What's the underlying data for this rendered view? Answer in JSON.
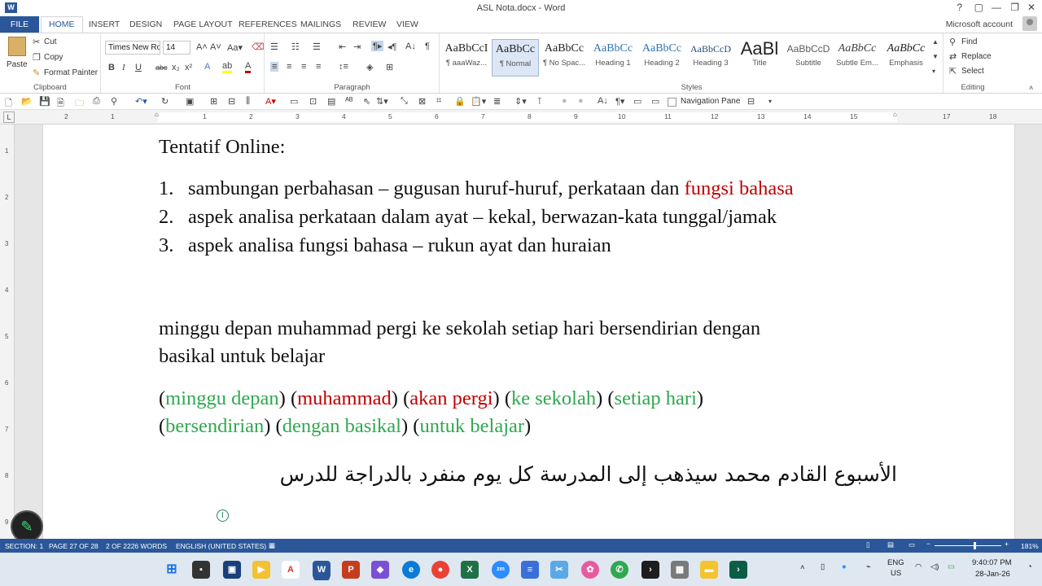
{
  "window": {
    "title": "ASL Nota.docx - Word",
    "app_icon": "W",
    "controls": [
      "?",
      "▢",
      "—",
      "❐",
      "✕"
    ]
  },
  "tabs": [
    "FILE",
    "HOME",
    "INSERT",
    "DESIGN",
    "PAGE LAYOUT",
    "REFERENCES",
    "MAILINGS",
    "REVIEW",
    "VIEW"
  ],
  "account": "Microsoft account",
  "ribbon": {
    "clipboard": {
      "paste": "Paste",
      "cut": "Cut",
      "copy": "Copy",
      "format_painter": "Format Painter",
      "label": "Clipboard"
    },
    "font": {
      "name": "Times New Ro",
      "size": "14",
      "label": "Font"
    },
    "paragraph": {
      "label": "Paragraph"
    },
    "styles": {
      "label": "Styles",
      "items": [
        {
          "preview": "AaBbCcI",
          "name": "¶ aaaWaz..."
        },
        {
          "preview": "AaBbCc",
          "name": "¶ Normal"
        },
        {
          "preview": "AaBbCc",
          "name": "¶ No Spac..."
        },
        {
          "preview": "AaBbCc",
          "name": "Heading 1"
        },
        {
          "preview": "AaBbCc",
          "name": "Heading 2"
        },
        {
          "preview": "AaBbCcD",
          "name": "Heading 3"
        },
        {
          "preview": "AaBl",
          "name": "Title"
        },
        {
          "preview": "AaBbCcD",
          "name": "Subtitle"
        },
        {
          "preview": "AaBbCc",
          "name": "Subtle Em..."
        },
        {
          "preview": "AaBbCc",
          "name": "Emphasis"
        }
      ]
    },
    "editing": {
      "find": "Find",
      "replace": "Replace",
      "select": "Select",
      "label": "Editing"
    }
  },
  "qat": {
    "navigation_pane": "Navigation Pane"
  },
  "ruler": {
    "numbers": [
      "2",
      "1",
      "1",
      "2",
      "3",
      "4",
      "5",
      "6",
      "7",
      "8",
      "9",
      "10",
      "11",
      "12",
      "13",
      "14",
      "15",
      "16",
      "17",
      "18"
    ],
    "tab_marker": "L"
  },
  "vruler": [
    "1",
    "2",
    "3",
    "4",
    "5",
    "6",
    "7",
    "8",
    "9"
  ],
  "document": {
    "heading": "Tentatif Online:",
    "list": [
      {
        "n": "1.",
        "text": "sambungan perbahasan – gugusan huruf-huruf, perkataan dan ",
        "highlight": "fungsi bahasa"
      },
      {
        "n": "2.",
        "text": "aspek analisa perkataan dalam ayat – kekal, berwazan-kata tunggal/jamak",
        "highlight": ""
      },
      {
        "n": "3.",
        "text": "aspek analisa fungsi bahasa – rukun ayat dan huraian",
        "highlight": ""
      }
    ],
    "sentence_line1": "minggu depan muhammad pergi ke sekolah setiap hari bersendirian dengan",
    "sentence_line2": "basikal untuk belajar",
    "phrases_line1": [
      {
        "text": "minggu depan",
        "color": "green"
      },
      {
        "text": "muhammad",
        "color": "red"
      },
      {
        "text": "akan pergi",
        "color": "red"
      },
      {
        "text": "ke sekolah",
        "color": "green"
      },
      {
        "text": "setiap hari",
        "color": "green"
      }
    ],
    "phrases_line2": [
      {
        "text": "bersendirian",
        "color": "green"
      },
      {
        "text": "dengan basikal",
        "color": "green"
      },
      {
        "text": "untuk belajar",
        "color": "green"
      }
    ],
    "arabic": "الأسبوع القادم محمد سيذهب إلى المدرسة كل يوم منفرد بالدراجة للدرس"
  },
  "status": {
    "section": "SECTION: 1",
    "page": "PAGE 27 OF 28",
    "words": "2 OF 2226 WORDS",
    "language": "ENGLISH (UNITED STATES)",
    "zoom": "181%",
    "zoom_level": 0.6
  },
  "taskbar": {
    "lang": "ENG",
    "region": "US",
    "time": "9:40:07 PM",
    "date": "28-Jan-26"
  },
  "colors": {
    "accent": "#2b579a",
    "red": "#c00000",
    "green": "#2fa84f"
  }
}
